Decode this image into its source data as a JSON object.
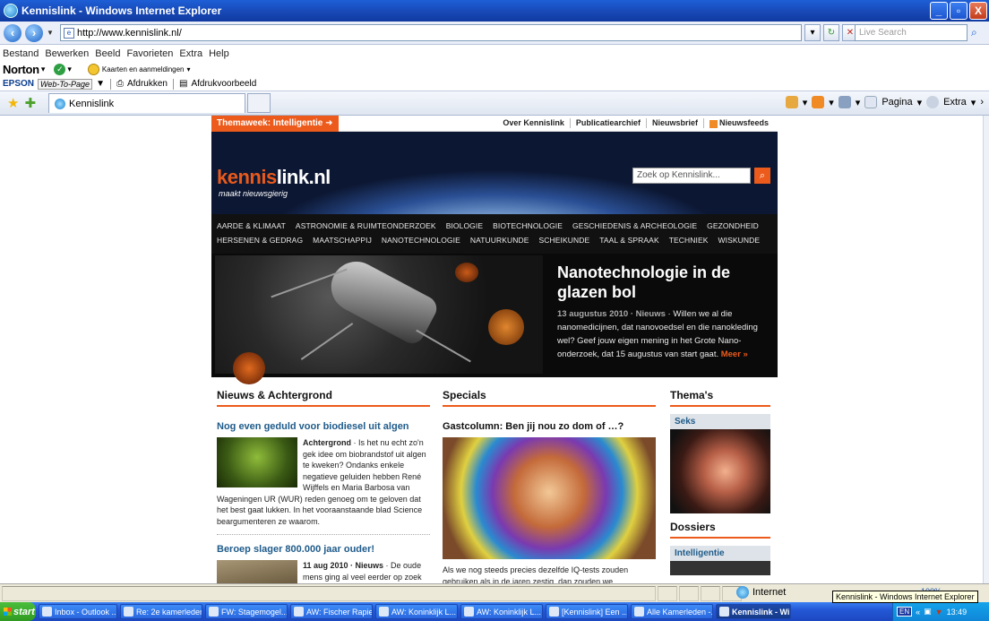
{
  "window": {
    "title": "Kennislink - Windows Internet Explorer",
    "minimize": "_",
    "maximize": "▫",
    "close": "X"
  },
  "address": {
    "url": "http://www.kennislink.nl/",
    "search_placeholder": "Live Search"
  },
  "menu": {
    "items": [
      "Bestand",
      "Bewerken",
      "Beeld",
      "Favorieten",
      "Extra",
      "Help"
    ]
  },
  "norton": {
    "brand": "Norton",
    "maps_label": "Kaarten en aanmeldingen"
  },
  "epson": {
    "brand": "EPSON",
    "web_to_page": "Web-To-Page",
    "print": "Afdrukken",
    "preview": "Afdrukvoorbeeld"
  },
  "tabs": {
    "active": "Kennislink"
  },
  "commandbar": {
    "page": "Pagina",
    "extra": "Extra"
  },
  "site": {
    "themaweek": "Themaweek: Intelligentie",
    "toplinks": [
      "Over Kennislink",
      "Publicatiearchief",
      "Nieuwsbrief",
      "Nieuwsfeeds"
    ],
    "logo_kennis": "kennis",
    "logo_rest": "link.nl",
    "tagline": "maakt nieuwsgierig",
    "search_placeholder": "Zoek op Kennislink...",
    "topics_row1": [
      "AARDE & KLIMAAT",
      "ASTRONOMIE & RUIMTEONDERZOEK",
      "BIOLOGIE",
      "BIOTECHNOLOGIE",
      "GESCHIEDENIS & ARCHEOLOGIE",
      "GEZONDHEID"
    ],
    "topics_row2": [
      "HERSENEN & GEDRAG",
      "MAATSCHAPPIJ",
      "NANOTECHNOLOGIE",
      "NATUURKUNDE",
      "SCHEIKUNDE",
      "TAAL & SPRAAK",
      "TECHNIEK",
      "WISKUNDE"
    ],
    "hero": {
      "title": "Nanotechnologie in de glazen bol",
      "date": "13 augustus 2010 · Nieuws",
      "text": " · Willen we al die nanomedicijnen, dat nanovoedsel en die nanokleding wel? Geef jouw eigen mening in het Grote Nano-onderzoek, dat 15 augustus van start gaat.",
      "more": "Meer »"
    },
    "nieuws": {
      "heading": "Nieuws & Achtergrond",
      "a1_title": "Nog even geduld voor biodiesel uit algen",
      "a1_kind": "Achtergrond",
      "a1_text": " · Is het nu echt zo'n gek idee om biobrandstof uit algen te kweken? Ondanks enkele negatieve geluiden hebben René Wijffels en Maria Barbosa van Wageningen UR (WUR) reden genoeg om te geloven dat het best gaat lukken. In het vooraanstaande blad Science beargumenteren ze waarom.",
      "a2_title": "Beroep slager 800.000 jaar ouder!",
      "a2_date": "11 aug 2010 · Nieuws",
      "a2_text": " · De oude mens ging al veel eerder op zoek naar groot wild dan gedacht zo blijkt uit"
    },
    "specials": {
      "heading": "Specials",
      "title": "Gastcolumn: Ben jij nou zo dom of …?",
      "text": "Als we nog steeds precies dezelfde IQ-tests zouden gebruiken als in de jaren zestig, dan zouden we opgescheept zitten met"
    },
    "themas": {
      "heading": "Thema's",
      "item": "Seks",
      "dossiers_heading": "Dossiers",
      "dossier_item": "Intelligentie"
    }
  },
  "statusbar": {
    "zone": "Internet",
    "zoom": "100%",
    "tooltip": "Kennislink - Windows Internet Explorer"
  },
  "taskbar": {
    "start": "start",
    "items": [
      "Inbox - Outlook ...",
      "Re: 2e kamerleden",
      "FW: Stagemogel...",
      "AW: Fischer Rapier",
      "AW: Koninklijk L...",
      "AW: Koninklijk L...",
      "[Kennislink] Een ...",
      "Alle Kamerleden -...",
      "Kennislink - Wi..."
    ],
    "lang": "EN",
    "time": "13:49"
  }
}
